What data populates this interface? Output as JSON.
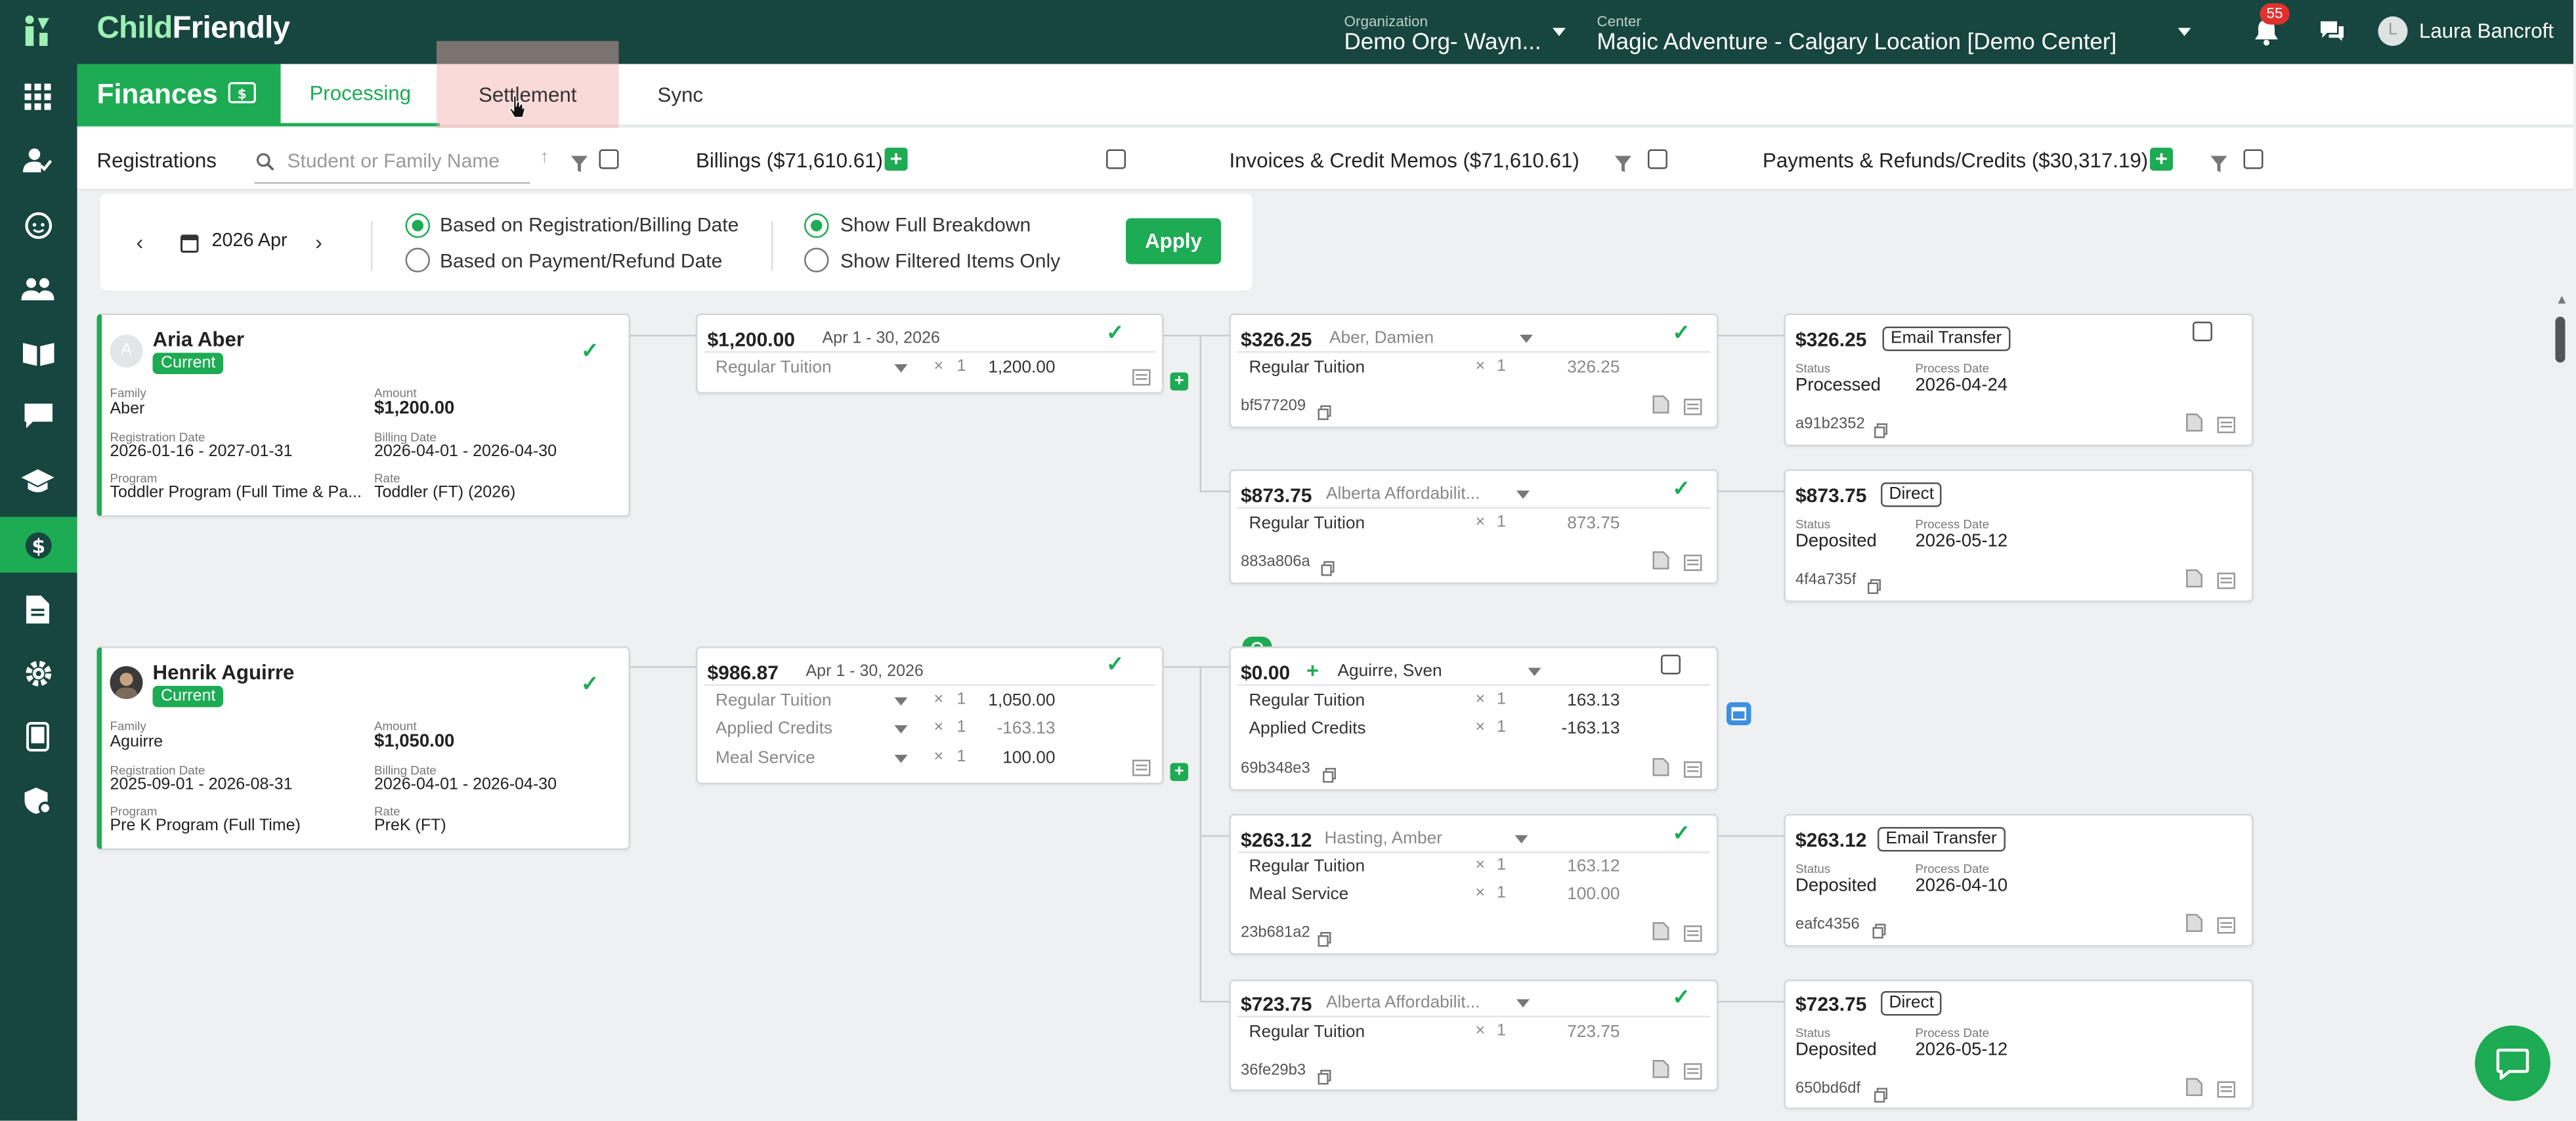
{
  "app": {
    "logo_a": "Child",
    "logo_b": "Friendly"
  },
  "header": {
    "org_label": "Organization",
    "org_value": "Demo Org- Wayn...",
    "center_label": "Center",
    "center_value": "Magic Adventure - Calgary Location [Demo Center]",
    "notif_count": "55",
    "user_initial": "L",
    "user_name": "Laura Bancroft"
  },
  "tabs": {
    "finances": "Finances",
    "processing": "Processing",
    "settlement": "Settlement",
    "sync": "Sync"
  },
  "toolbar": {
    "registrations": "Registrations",
    "search_placeholder": "Student or Family Name",
    "billings": "Billings ($71,610.61)",
    "invoices": "Invoices & Credit Memos ($71,610.61)",
    "payments": "Payments & Refunds/Credits ($30,317.19)"
  },
  "filter": {
    "month": "2026 Apr",
    "opt_reg": "Based on Registration/Billing Date",
    "opt_pay": "Based on Payment/Refund Date",
    "opt_full": "Show Full Breakdown",
    "opt_filtered": "Show Filtered Items Only",
    "apply": "Apply"
  },
  "labels": {
    "family": "Family",
    "amount": "Amount",
    "reg_date": "Registration Date",
    "billing_date": "Billing Date",
    "program": "Program",
    "rate": "Rate",
    "status": "Status",
    "process_date": "Process Date"
  },
  "registrations": [
    {
      "initial": "A",
      "name": "Aria Aber",
      "status": "Current",
      "family": "Aber",
      "amount": "$1,200.00",
      "reg_date": "2026-01-16 - 2027-01-31",
      "billing_date": "2026-04-01 - 2026-04-30",
      "program": "Toddler Program (Full Time & Pa...",
      "rate": "Toddler (FT) (2026)"
    },
    {
      "initial": "",
      "name": "Henrik Aguirre",
      "status": "Current",
      "family": "Aguirre",
      "amount": "$1,050.00",
      "reg_date": "2025-09-01 - 2026-08-31",
      "billing_date": "2026-04-01 - 2026-04-30",
      "program": "Pre K Program (Full Time)",
      "rate": "PreK (FT)"
    }
  ],
  "billings": [
    {
      "amount": "$1,200.00",
      "period": "Apr 1 - 30, 2026",
      "lines": [
        {
          "name": "Regular Tuition",
          "x": "×",
          "qty": "1",
          "amount": "1,200.00"
        }
      ]
    },
    {
      "amount": "$986.87",
      "period": "Apr 1 - 30, 2026",
      "lines": [
        {
          "name": "Regular Tuition",
          "x": "×",
          "qty": "1",
          "amount": "1,050.00"
        },
        {
          "name": "Applied Credits",
          "x": "×",
          "qty": "1",
          "amount": "-163.13"
        },
        {
          "name": "Meal Service",
          "x": "×",
          "qty": "1",
          "amount": "100.00"
        }
      ]
    }
  ],
  "invoices": [
    {
      "amount": "$326.25",
      "payer": "Aber, Damien",
      "code": "bf577209",
      "lines": [
        {
          "name": "Regular Tuition",
          "x": "×",
          "qty": "1",
          "amount": "326.25"
        }
      ]
    },
    {
      "amount": "$873.75",
      "payer": "Alberta Affordabilit...",
      "code": "883a806a",
      "lines": [
        {
          "name": "Regular Tuition",
          "x": "×",
          "qty": "1",
          "amount": "873.75"
        }
      ]
    },
    {
      "amount": "$0.00",
      "payer": "Aguirre, Sven",
      "code": "69b348e3",
      "lines": [
        {
          "name": "Regular Tuition",
          "x": "×",
          "qty": "1",
          "amount": "163.13"
        },
        {
          "name": "Applied Credits",
          "x": "×",
          "qty": "1",
          "amount": "-163.13"
        }
      ]
    },
    {
      "amount": "$263.12",
      "payer": "Hasting, Amber",
      "code": "23b681a2",
      "lines": [
        {
          "name": "Regular Tuition",
          "x": "×",
          "qty": "1",
          "amount": "163.12"
        },
        {
          "name": "Meal Service",
          "x": "×",
          "qty": "1",
          "amount": "100.00"
        }
      ]
    },
    {
      "amount": "$723.75",
      "payer": "Alberta Affordabilit...",
      "code": "36fe29b3",
      "lines": [
        {
          "name": "Regular Tuition",
          "x": "×",
          "qty": "1",
          "amount": "723.75"
        }
      ]
    }
  ],
  "payments": [
    {
      "amount": "$326.25",
      "method": "Email Transfer",
      "status": "Processed",
      "date": "2026-04-24",
      "code": "a91b2352"
    },
    {
      "amount": "$873.75",
      "method": "Direct",
      "status": "Deposited",
      "date": "2026-05-12",
      "code": "4f4a735f"
    },
    {
      "amount": "$263.12",
      "method": "Email Transfer",
      "status": "Deposited",
      "date": "2026-04-10",
      "code": "eafc4356"
    },
    {
      "amount": "$723.75",
      "method": "Direct",
      "status": "Deposited",
      "date": "2026-05-12",
      "code": "650bd6df"
    }
  ],
  "colors": {
    "brand_dark": "#17453f",
    "brand_green": "#1dab53",
    "notif_red": "#e0312f"
  }
}
